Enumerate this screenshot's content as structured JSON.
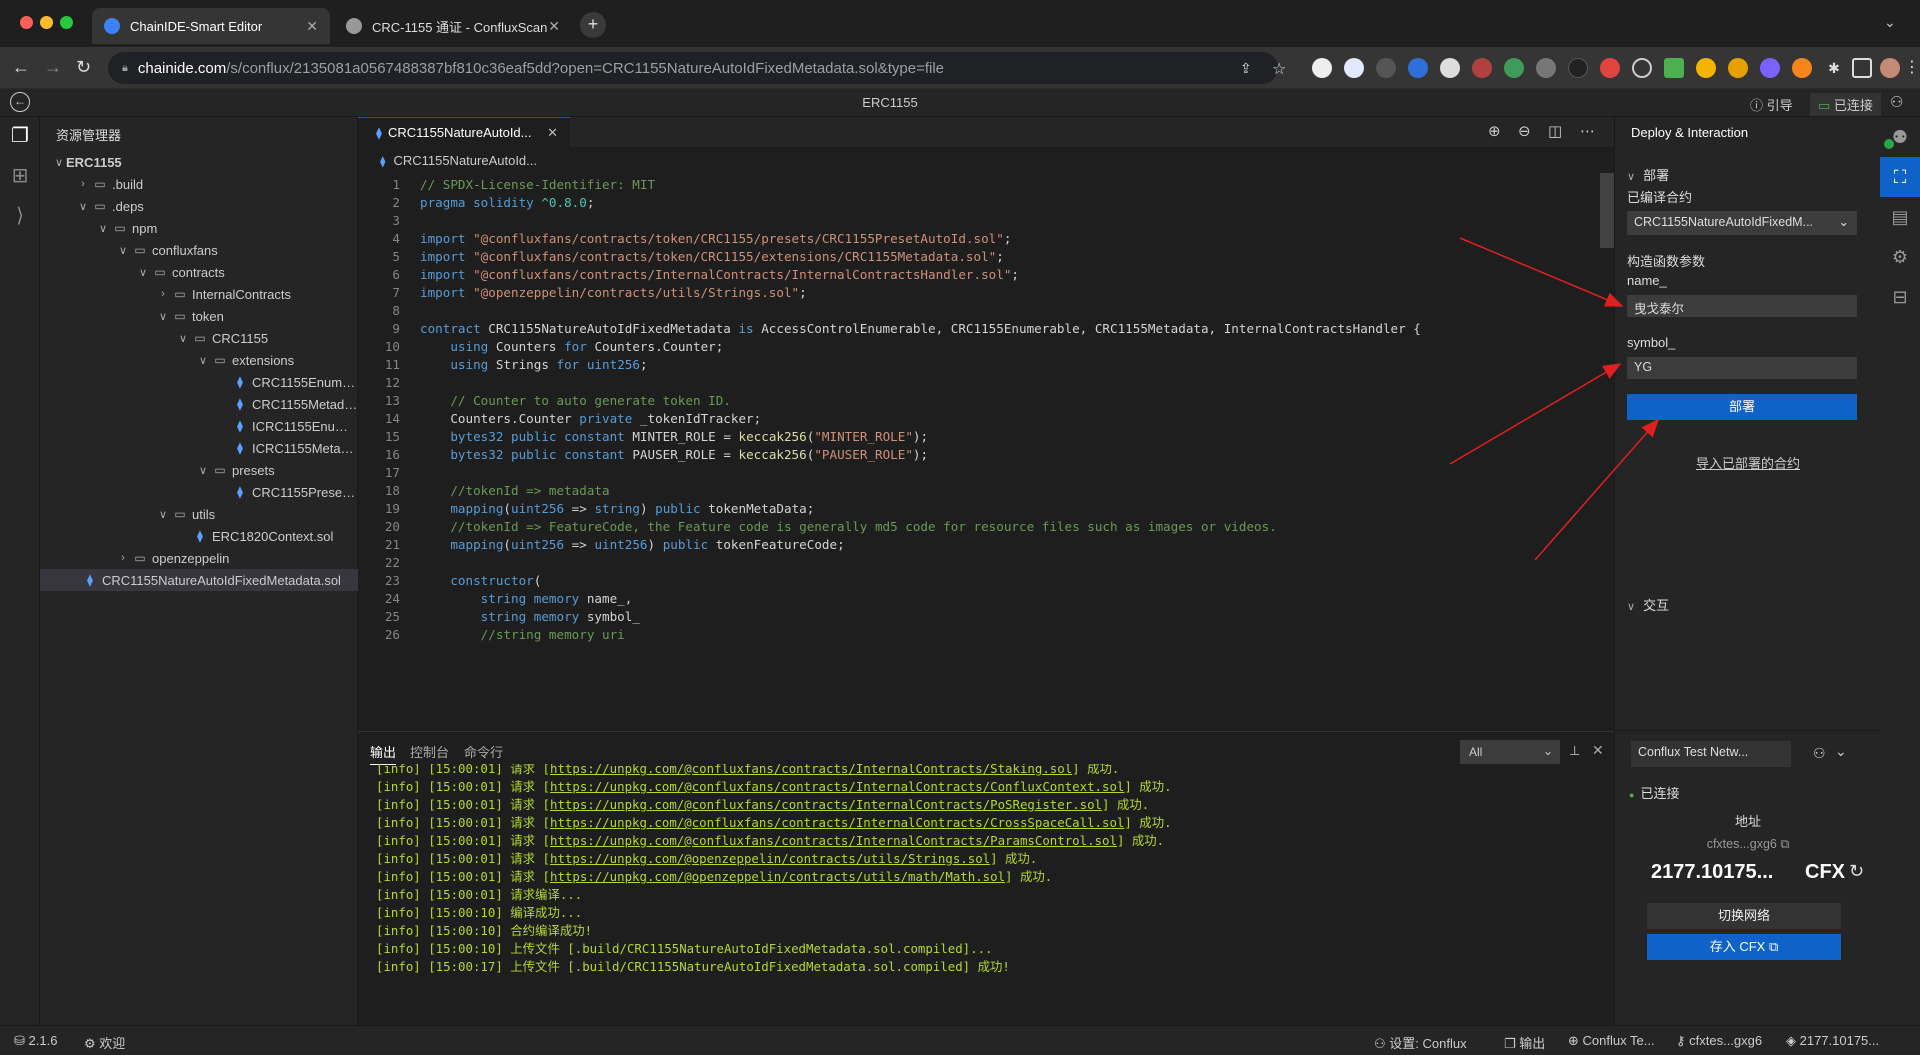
{
  "browser": {
    "tabs": [
      {
        "label": "ChainIDE-Smart Editor",
        "active": true
      },
      {
        "label": "CRC-1155 通证 - ConfluxScan",
        "active": false
      }
    ],
    "url_host": "chainide.com",
    "url_rest": "/s/conflux/2135081a0567488387bf810c36eaf5dd?open=CRC1155NatureAutoIdFixedMetadata.sol&type=file"
  },
  "header": {
    "title": "ERC1155",
    "guide_label": "引导",
    "connected_label": "已连接"
  },
  "explorer": {
    "title": "资源管理器",
    "tree": [
      {
        "label": "ERC1155",
        "depth": 0,
        "type": "root",
        "open": true
      },
      {
        "label": ".build",
        "depth": 1,
        "type": "folder",
        "open": false
      },
      {
        "label": ".deps",
        "depth": 1,
        "type": "folder",
        "open": true
      },
      {
        "label": "npm",
        "depth": 2,
        "type": "folder",
        "open": true
      },
      {
        "label": "confluxfans",
        "depth": 3,
        "type": "folder",
        "open": true
      },
      {
        "label": "contracts",
        "depth": 4,
        "type": "folder",
        "open": true
      },
      {
        "label": "InternalContracts",
        "depth": 5,
        "type": "folder",
        "open": false
      },
      {
        "label": "token",
        "depth": 5,
        "type": "folder",
        "open": true
      },
      {
        "label": "CRC1155",
        "depth": 6,
        "type": "folder",
        "open": true
      },
      {
        "label": "extensions",
        "depth": 7,
        "type": "folder",
        "open": true
      },
      {
        "label": "CRC1155Enumera...",
        "depth": 8,
        "type": "sol"
      },
      {
        "label": "CRC1155Metadata...",
        "depth": 8,
        "type": "sol"
      },
      {
        "label": "ICRC1155Enumera...",
        "depth": 8,
        "type": "sol"
      },
      {
        "label": "ICRC1155Metadat...",
        "depth": 8,
        "type": "sol"
      },
      {
        "label": "presets",
        "depth": 7,
        "type": "folder",
        "open": true
      },
      {
        "label": "CRC1155PresetAu...",
        "depth": 8,
        "type": "sol"
      },
      {
        "label": "utils",
        "depth": 5,
        "type": "folder",
        "open": true
      },
      {
        "label": "ERC1820Context.sol",
        "depth": 6,
        "type": "sol"
      },
      {
        "label": "openzeppelin",
        "depth": 3,
        "type": "folder",
        "open": false
      },
      {
        "label": "CRC1155NatureAutoIdFixedMetadata.sol",
        "depth": 0,
        "type": "sol",
        "selected": true
      }
    ]
  },
  "editor": {
    "tab_label": "CRC1155NatureAutoId...",
    "breadcrumb": "CRC1155NatureAutoId...",
    "lines": [
      [
        [
          "c",
          "// SPDX-License-Identifier: MIT"
        ]
      ],
      [
        [
          "k",
          "pragma solidity "
        ],
        [
          "t",
          "^0.8.0"
        ],
        [
          "p",
          ";"
        ]
      ],
      [],
      [
        [
          "k",
          "import "
        ],
        [
          "s",
          "\"@confluxfans/contracts/token/CRC1155/presets/CRC1155PresetAutoId.sol\""
        ],
        [
          "p",
          ";"
        ]
      ],
      [
        [
          "k",
          "import "
        ],
        [
          "s",
          "\"@confluxfans/contracts/token/CRC1155/extensions/CRC1155Metadata.sol\""
        ],
        [
          "p",
          ";"
        ]
      ],
      [
        [
          "k",
          "import "
        ],
        [
          "s",
          "\"@confluxfans/contracts/InternalContracts/InternalContractsHandler.sol\""
        ],
        [
          "p",
          ";"
        ]
      ],
      [
        [
          "k",
          "import "
        ],
        [
          "s",
          "\"@openzeppelin/contracts/utils/Strings.sol\""
        ],
        [
          "p",
          ";"
        ]
      ],
      [],
      [
        [
          "k",
          "contract "
        ],
        [
          "p",
          "CRC1155NatureAutoIdFixedMetadata "
        ],
        [
          "k",
          "is "
        ],
        [
          "p",
          "AccessControlEnumerable, CRC1155Enumerable, CRC1155Metadata, InternalContractsHandler {"
        ]
      ],
      [
        [
          "p",
          "    "
        ],
        [
          "k",
          "using "
        ],
        [
          "p",
          "Counters "
        ],
        [
          "k",
          "for "
        ],
        [
          "p",
          "Counters.Counter;"
        ]
      ],
      [
        [
          "p",
          "    "
        ],
        [
          "k",
          "using "
        ],
        [
          "p",
          "Strings "
        ],
        [
          "k",
          "for "
        ],
        [
          "k",
          "uint256"
        ],
        [
          "p",
          ";"
        ]
      ],
      [],
      [
        [
          "p",
          "    "
        ],
        [
          "c",
          "// Counter to auto generate token ID."
        ]
      ],
      [
        [
          "p",
          "    Counters.Counter "
        ],
        [
          "k",
          "private "
        ],
        [
          "p",
          "_tokenIdTracker;"
        ]
      ],
      [
        [
          "p",
          "    "
        ],
        [
          "k",
          "bytes32 public constant "
        ],
        [
          "p",
          "MINTER_ROLE = "
        ],
        [
          "f",
          "keccak256"
        ],
        [
          "p",
          "("
        ],
        [
          "s",
          "\"MINTER_ROLE\""
        ],
        [
          "p",
          ");"
        ]
      ],
      [
        [
          "p",
          "    "
        ],
        [
          "k",
          "bytes32 public constant "
        ],
        [
          "p",
          "PAUSER_ROLE = "
        ],
        [
          "f",
          "keccak256"
        ],
        [
          "p",
          "("
        ],
        [
          "s",
          "\"PAUSER_ROLE\""
        ],
        [
          "p",
          ");"
        ]
      ],
      [],
      [
        [
          "p",
          "    "
        ],
        [
          "c",
          "//tokenId => metadata"
        ]
      ],
      [
        [
          "p",
          "    "
        ],
        [
          "k",
          "mapping"
        ],
        [
          "p",
          "("
        ],
        [
          "k",
          "uint256"
        ],
        [
          "p",
          " => "
        ],
        [
          "k",
          "string"
        ],
        [
          "p",
          ") "
        ],
        [
          "k",
          "public "
        ],
        [
          "p",
          "tokenMetaData;"
        ]
      ],
      [
        [
          "p",
          "    "
        ],
        [
          "c",
          "//tokenId => FeatureCode, the Feature code is generally md5 code for resource files such as images or videos."
        ]
      ],
      [
        [
          "p",
          "    "
        ],
        [
          "k",
          "mapping"
        ],
        [
          "p",
          "("
        ],
        [
          "k",
          "uint256"
        ],
        [
          "p",
          " => "
        ],
        [
          "k",
          "uint256"
        ],
        [
          "p",
          ") "
        ],
        [
          "k",
          "public "
        ],
        [
          "p",
          "tokenFeatureCode;"
        ]
      ],
      [],
      [
        [
          "p",
          "    "
        ],
        [
          "k",
          "constructor"
        ],
        [
          "p",
          "("
        ]
      ],
      [
        [
          "p",
          "        "
        ],
        [
          "k",
          "string memory "
        ],
        [
          "p",
          "name_,"
        ]
      ],
      [
        [
          "p",
          "        "
        ],
        [
          "k",
          "string memory "
        ],
        [
          "p",
          "symbol_"
        ]
      ],
      [
        [
          "p",
          "        "
        ],
        [
          "c",
          "//string memory uri"
        ]
      ]
    ]
  },
  "output": {
    "tabs": [
      "输出",
      "控制台",
      "命令行"
    ],
    "filter": "All",
    "logs": [
      {
        "pre": "[info] [15:00:01] 请求 [",
        "url": "https://unpkg.com/@confluxfans/contracts/InternalContracts/Staking.sol",
        "post": "] 成功."
      },
      {
        "pre": "[info] [15:00:01] 请求 [",
        "url": "https://unpkg.com/@confluxfans/contracts/InternalContracts/ConfluxContext.sol",
        "post": "] 成功."
      },
      {
        "pre": "[info] [15:00:01] 请求 [",
        "url": "https://unpkg.com/@confluxfans/contracts/InternalContracts/PoSRegister.sol",
        "post": "] 成功."
      },
      {
        "pre": "[info] [15:00:01] 请求 [",
        "url": "https://unpkg.com/@confluxfans/contracts/InternalContracts/CrossSpaceCall.sol",
        "post": "] 成功."
      },
      {
        "pre": "[info] [15:00:01] 请求 [",
        "url": "https://unpkg.com/@confluxfans/contracts/InternalContracts/ParamsControl.sol",
        "post": "] 成功."
      },
      {
        "pre": "[info] [15:00:01] 请求 [",
        "url": "https://unpkg.com/@openzeppelin/contracts/utils/Strings.sol",
        "post": "] 成功."
      },
      {
        "pre": "[info] [15:00:01] 请求 [",
        "url": "https://unpkg.com/@openzeppelin/contracts/utils/math/Math.sol",
        "post": "] 成功."
      },
      {
        "pre": "[info] [15:00:01] 请求编译...",
        "url": "",
        "post": ""
      },
      {
        "pre": "[info] [15:00:10] 编译成功...",
        "url": "",
        "post": ""
      },
      {
        "pre": "[info] [15:00:10] 合约编译成功!",
        "url": "",
        "post": ""
      },
      {
        "pre": "[info] [15:00:10] 上传文件 [.build/CRC1155NatureAutoIdFixedMetadata.sol.compiled]...",
        "url": "",
        "post": ""
      },
      {
        "pre": "[info] [15:00:17] 上传文件 [.build/CRC1155NatureAutoIdFixedMetadata.sol.compiled] 成功!",
        "url": "",
        "post": ""
      }
    ]
  },
  "deploy": {
    "title": "Deploy & Interaction",
    "section_deploy": "部署",
    "compiled_label": "已编译合约",
    "compiled_value": "CRC1155NatureAutoIdFixedM...",
    "ctor_label": "构造函数参数",
    "name_label": "name_",
    "name_value": "曳戈泰尔",
    "symbol_label": "symbol_",
    "symbol_value": "YG",
    "deploy_button": "部署",
    "import_link": "导入已部署的合约",
    "section_interact": "交互",
    "network_value": "Conflux Test Netw...",
    "connected_status": "已连接",
    "address_label": "地址",
    "address_value": "cfxtes...gxg6",
    "balance_value": "2177.10175...",
    "balance_unit": "CFX",
    "switch_network": "切换网络",
    "deposit_button": "存入 CFX"
  },
  "statusbar": {
    "version": "2.1.6",
    "welcome": "欢迎",
    "settings": "设置: Conflux",
    "output": "输出",
    "network": "Conflux Te...",
    "address": "cfxtes...gxg6",
    "balance": "2177.10175..."
  },
  "colors": {
    "accent": "#0e62c8",
    "log_green": "#b3d930",
    "annotation_red": "#e02020"
  }
}
